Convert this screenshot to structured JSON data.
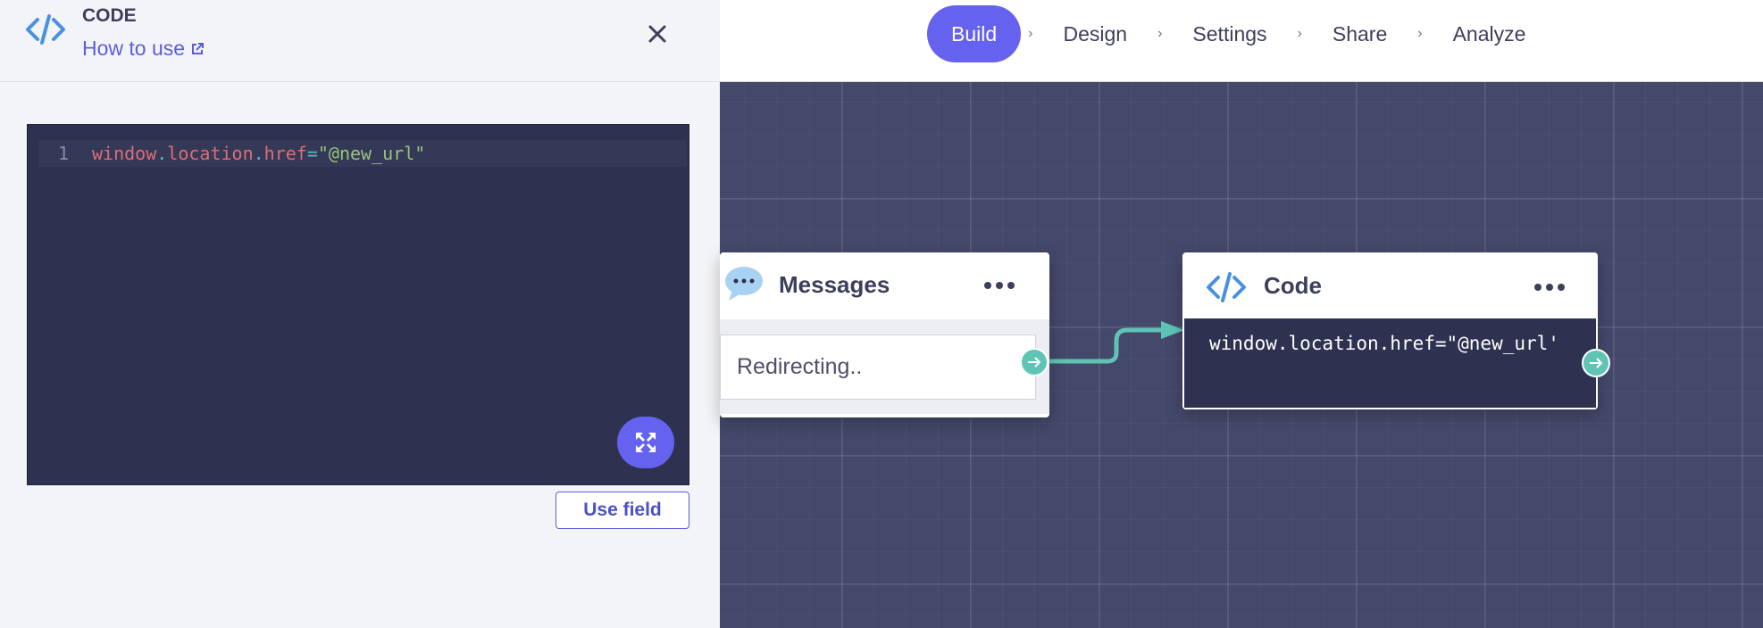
{
  "panel": {
    "title": "CODE",
    "how_to_use": "How to use",
    "editor": {
      "line_number": "1",
      "tokens": {
        "obj": "window",
        "dot1": ".",
        "prop1": "location",
        "dot2": ".",
        "prop2": "href",
        "eq": "=",
        "str": "\"@new_url\""
      }
    },
    "use_field_label": "Use field"
  },
  "nav": {
    "steps": [
      {
        "label": "Build"
      },
      {
        "label": "Design"
      },
      {
        "label": "Settings"
      },
      {
        "label": "Share"
      },
      {
        "label": "Analyze"
      }
    ],
    "chevron": "›",
    "active": "Build"
  },
  "nodes": {
    "messages": {
      "title": "Messages",
      "text": "Redirecting.."
    },
    "code": {
      "title": "Code",
      "code": "window.location.href=\"@new_url'"
    }
  },
  "colors": {
    "accent": "#6562f0",
    "port": "#5fc4b6",
    "canvas": "#44486a",
    "editor_bg": "#2e3150"
  },
  "icons": {
    "panel": "code-brackets-icon",
    "close": "close-icon",
    "external": "external-link-icon",
    "expand": "expand-icon"
  }
}
